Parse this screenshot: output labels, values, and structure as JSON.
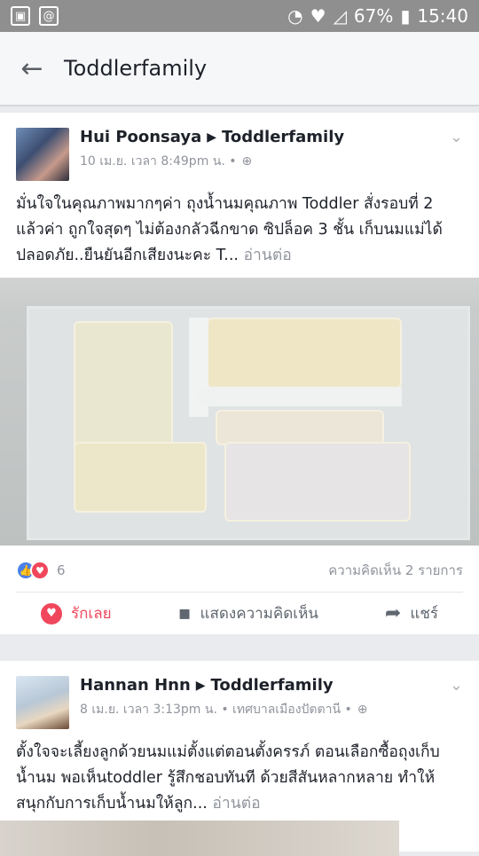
{
  "status": {
    "battery": "67%",
    "time": "15:40"
  },
  "appbar": {
    "title": "Toddlerfamily"
  },
  "post1": {
    "author": "Hui Poonsaya",
    "group": "Toddlerfamily",
    "meta": "10 เม.ย. เวลา 8:49pm น. •",
    "text": "มั่นใจในคุณภาพมากๆค่า ถุงน้ำนมคุณภาพ Toddler สั่งรอบที่ 2 แล้วค่า ถูกใจสุดๆ ไม่ต้องกลัวฉีกขาด ซิปล็อค 3 ชั้น เก็บนมแม่ได้ปลอดภัย..ยืนยันอีกเสียงนะคะ T...",
    "more": "อ่านต่อ",
    "reaction_count": "6",
    "comments": "ความคิดเห็น 2 รายการ",
    "actions": {
      "love": "รักเลย",
      "comment": "แสดงความคิดเห็น",
      "share": "แชร์"
    }
  },
  "post2": {
    "author": "Hannan Hnn",
    "group": "Toddlerfamily",
    "meta": "8 เม.ย. เวลา 3:13pm น. • เทศบาลเมืองปัตตานี •",
    "text": "ตั้งใจจะเลี้ยงลูกด้วยนมแม่ตั้งแต่ตอนตั้งครรภ์ ตอนเลือกซื้อถุงเก็บน้ำนม พอเห็นtoddler รู้สึกชอบทันที ด้วยสีสันหลากหลาย ทำให้สนุกกับการเก็บน้ำนมให้ลูก...",
    "more": "อ่านต่อ"
  },
  "icons": {
    "back": "arrow-left-icon",
    "globe": "globe-icon",
    "chevron": "chevron-down-icon"
  },
  "colors": {
    "status_bar": "#8f8f8f",
    "love": "#f0475c",
    "like": "#4a80e8"
  }
}
